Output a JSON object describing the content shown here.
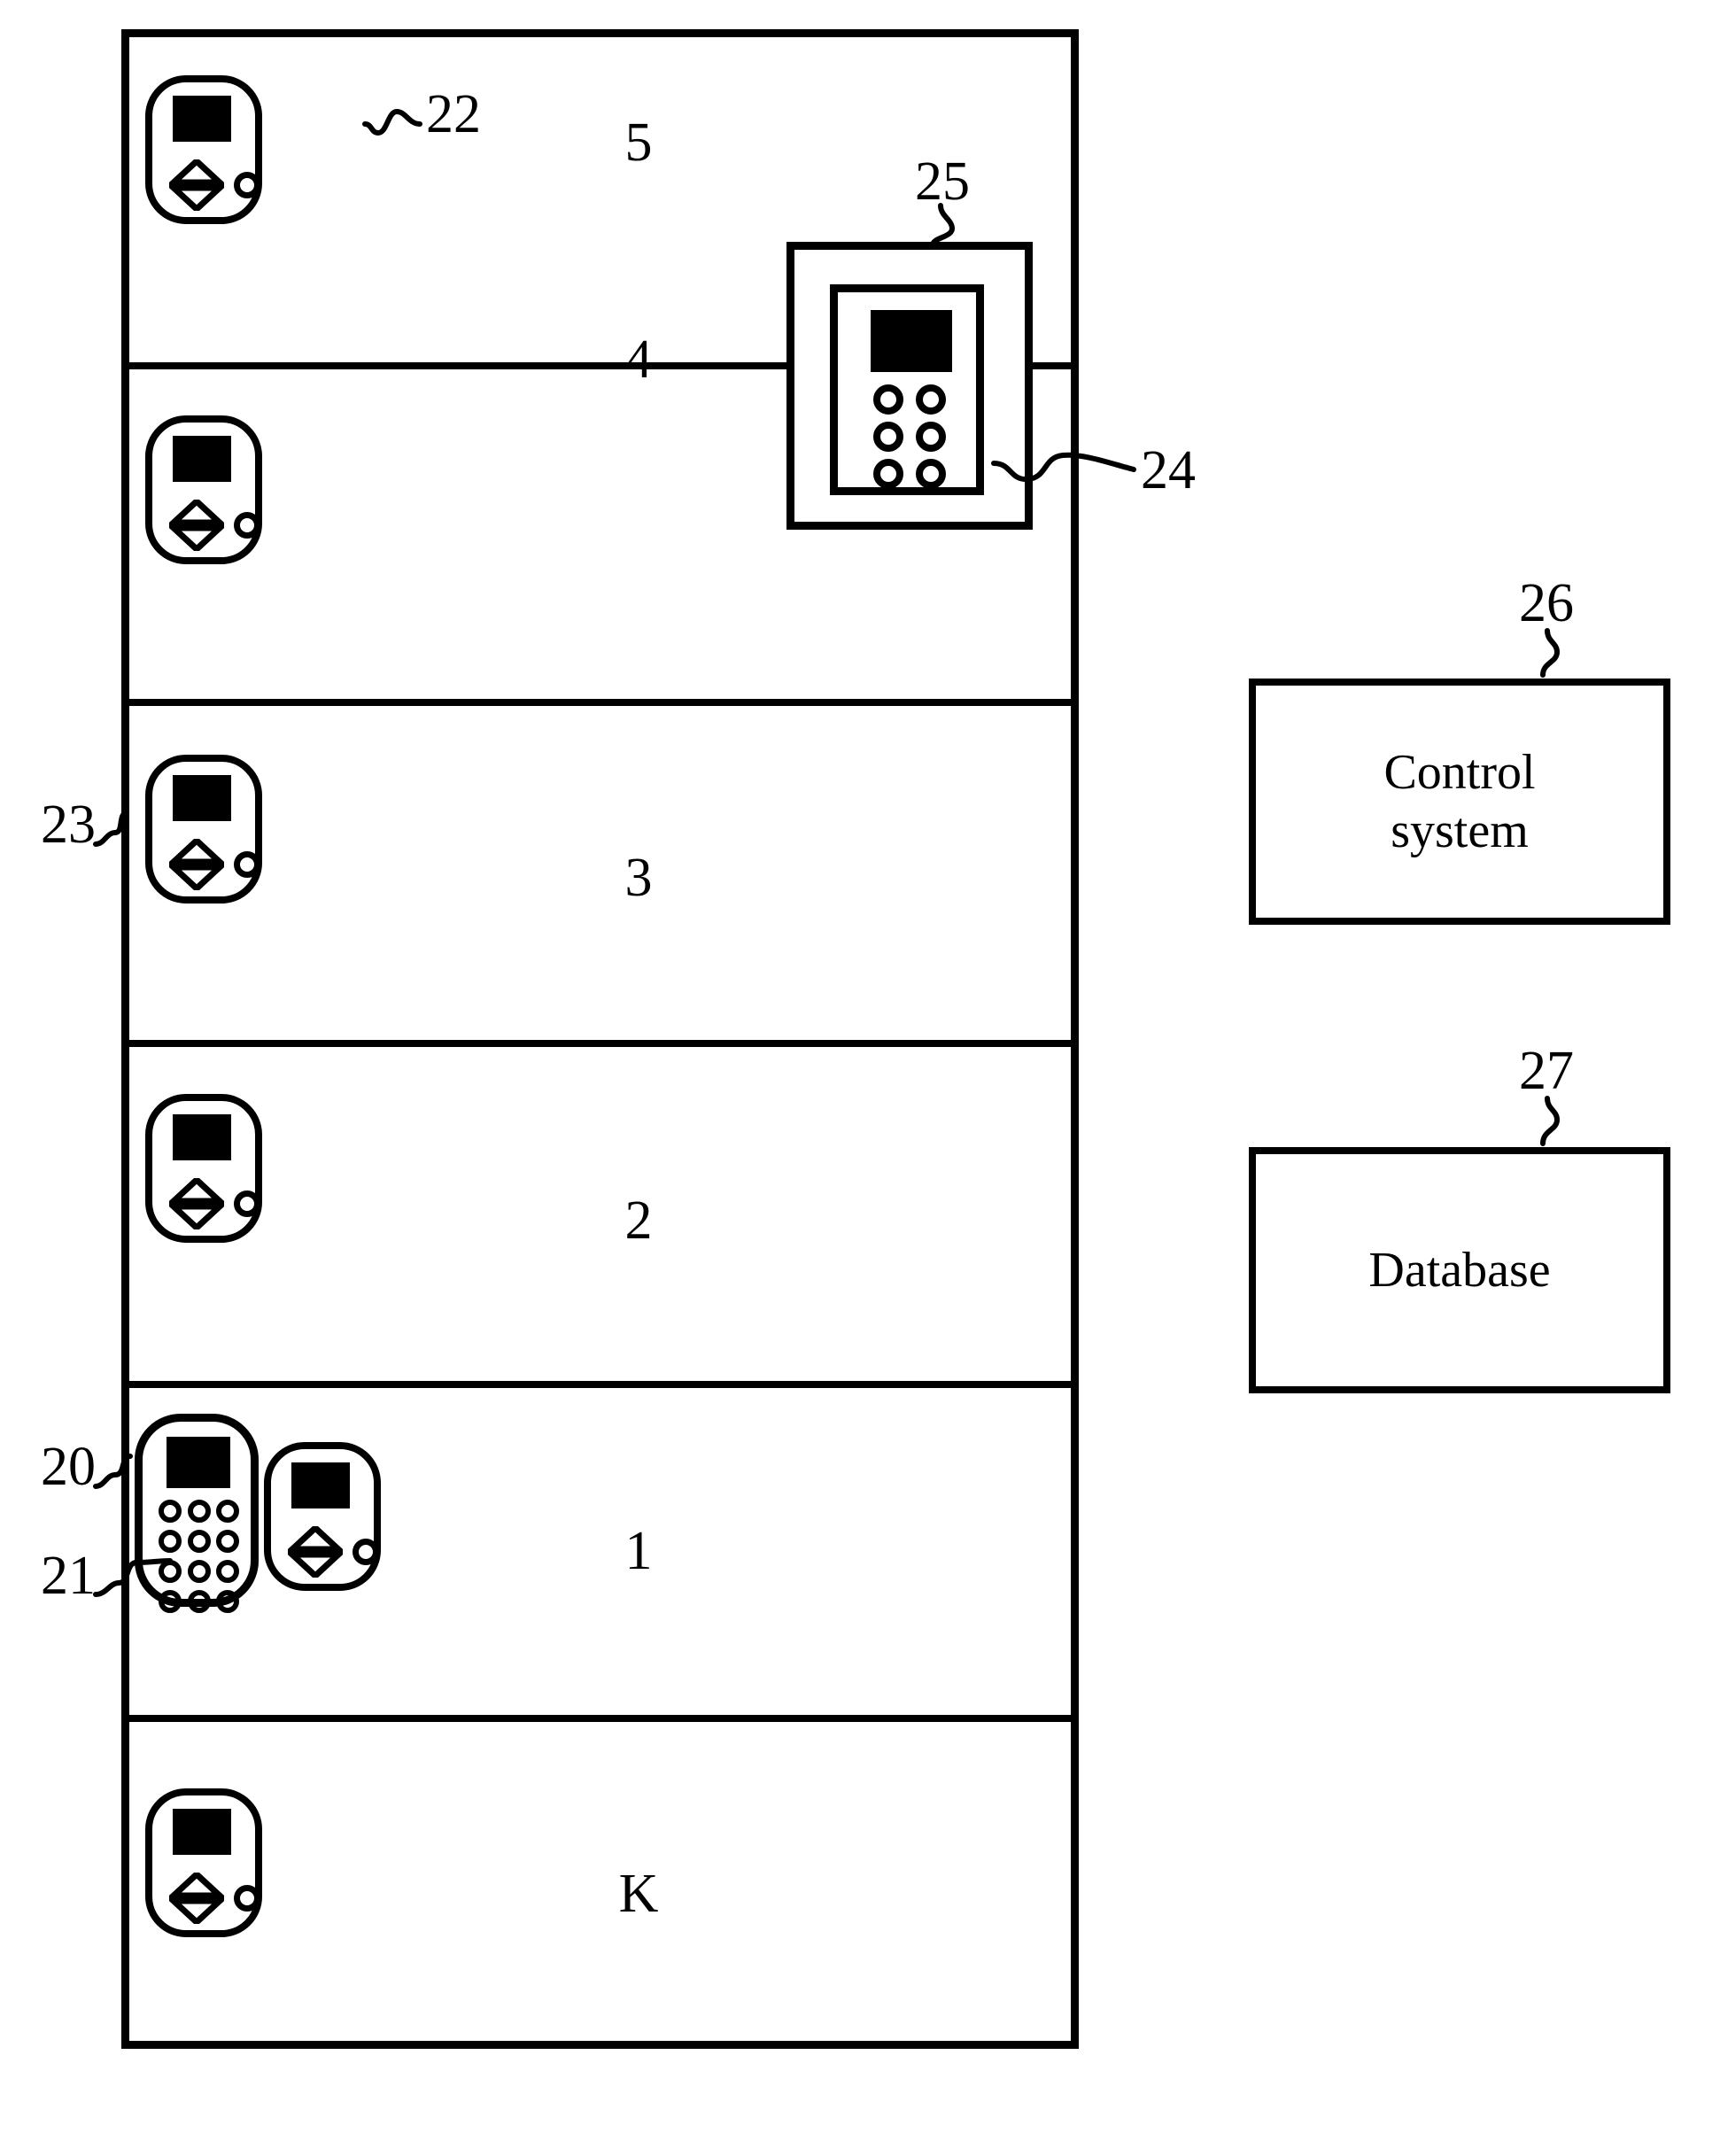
{
  "diagram": {
    "type": "patent-figure",
    "subject": "elevator-system-schematic",
    "background_color": "#ffffff",
    "line_color": "#000000"
  },
  "building": {
    "name": "building-shaft",
    "floors": [
      {
        "label": "5",
        "has_landing_panel": true,
        "has_keypad": false
      },
      {
        "label": "4",
        "has_landing_panel": true,
        "has_keypad": false
      },
      {
        "label": "3",
        "has_landing_panel": true,
        "has_keypad": false
      },
      {
        "label": "2",
        "has_landing_panel": true,
        "has_keypad": false
      },
      {
        "label": "1",
        "has_landing_panel": true,
        "has_keypad": true
      },
      {
        "label": "K",
        "has_landing_panel": true,
        "has_keypad": false
      }
    ]
  },
  "elevator_car": {
    "reference": "25",
    "panel_reference": "24",
    "panel_button_rows": 3,
    "panel_button_cols": 2,
    "panel_button_count": 6
  },
  "keypad_terminal": {
    "reference": "21",
    "button_rows": 4,
    "button_cols": 3,
    "button_count": 12
  },
  "landing_panel": {
    "reference": "22",
    "controls": [
      "up-arrow",
      "down-arrow",
      "round-button"
    ]
  },
  "shaft_wall": {
    "reference": "23"
  },
  "floor_one_marker": {
    "reference": "20"
  },
  "boxes": [
    {
      "reference": "26",
      "label": "Control\nsystem"
    },
    {
      "reference": "27",
      "label": "Database"
    }
  ],
  "reference_numerals": {
    "landing_panel": "22",
    "car": "25",
    "car_panel": "24",
    "shaft_wall": "23",
    "floor_marker": "20",
    "keypad": "21",
    "control_system": "26",
    "database": "27"
  }
}
